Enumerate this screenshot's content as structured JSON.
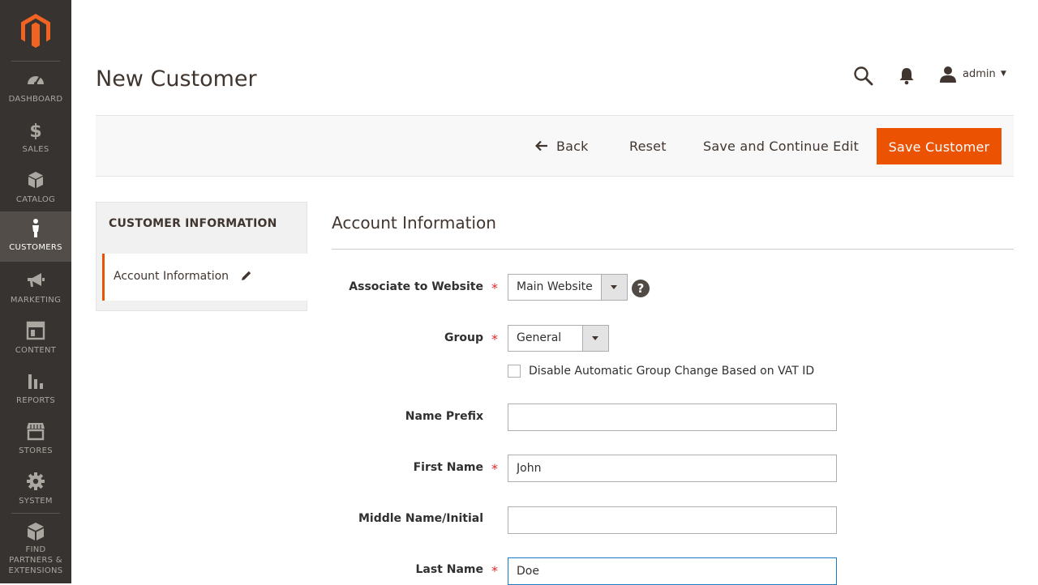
{
  "sidebar": {
    "items": [
      {
        "label": "DASHBOARD",
        "icon": "dashboard-icon"
      },
      {
        "label": "SALES",
        "icon": "dollar-icon"
      },
      {
        "label": "CATALOG",
        "icon": "box-icon"
      },
      {
        "label": "CUSTOMERS",
        "icon": "person-icon",
        "active": true
      },
      {
        "label": "MARKETING",
        "icon": "megaphone-icon"
      },
      {
        "label": "CONTENT",
        "icon": "layout-icon"
      },
      {
        "label": "REPORTS",
        "icon": "bar-chart-icon"
      },
      {
        "label": "STORES",
        "icon": "storefront-icon"
      },
      {
        "label": "SYSTEM",
        "icon": "gear-icon"
      },
      {
        "label_lines": [
          "FIND",
          "PARTNERS &",
          "EXTENSIONS"
        ],
        "icon": "extensions-box-icon"
      }
    ]
  },
  "header": {
    "title": "New Customer",
    "user": "admin"
  },
  "actions": {
    "back": "Back",
    "reset": "Reset",
    "save_continue": "Save and Continue Edit",
    "save": "Save Customer"
  },
  "tabs": {
    "title": "CUSTOMER INFORMATION",
    "items": [
      {
        "label": "Account Information"
      }
    ]
  },
  "form": {
    "section_title": "Account Information",
    "website": {
      "label": "Associate to Website",
      "value": "Main Website"
    },
    "group": {
      "label": "Group",
      "value": "General"
    },
    "disable_auto_group": {
      "label": "Disable Automatic Group Change Based on VAT ID",
      "checked": false
    },
    "name_prefix": {
      "label": "Name Prefix",
      "value": ""
    },
    "first_name": {
      "label": "First Name",
      "value": "John"
    },
    "middle_name": {
      "label": "Middle Name/Initial",
      "value": ""
    },
    "last_name": {
      "label": "Last Name",
      "value": "Doe"
    }
  },
  "colors": {
    "accent": "#eb5202",
    "sidebar_bg": "#373330",
    "required": "#e22626"
  }
}
